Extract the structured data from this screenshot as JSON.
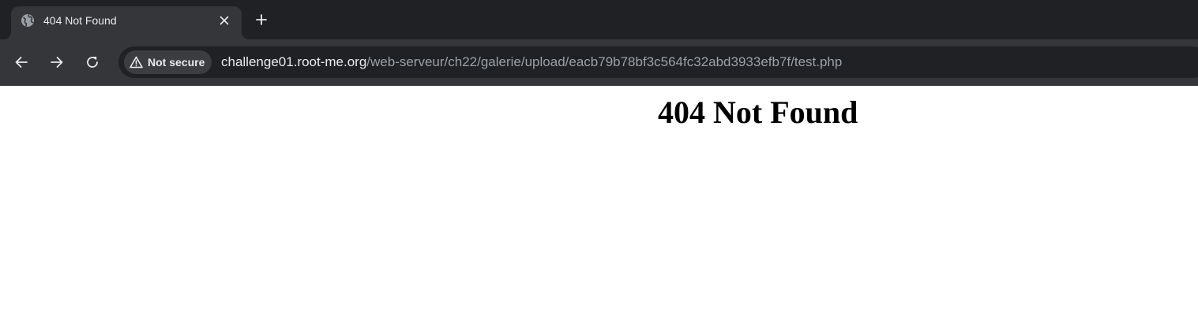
{
  "browser": {
    "tab": {
      "title": "404 Not Found",
      "favicon_icon": "globe-icon",
      "close_icon": "close-icon"
    },
    "new_tab_icon": "plus-icon",
    "toolbar": {
      "back_icon": "arrow-left-icon",
      "forward_icon": "arrow-right-icon",
      "reload_icon": "reload-icon"
    },
    "omnibox": {
      "security_icon": "warning-triangle-icon",
      "security_label": "Not secure",
      "url_host": "challenge01.root-me.org",
      "url_path": "/web-serveur/ch22/galerie/upload/eacb79b78bf3c564fc32abd3933efb7f/test.php"
    }
  },
  "page": {
    "heading": "404 Not Found"
  },
  "colors": {
    "tab_strip_bg": "#202124",
    "toolbar_bg": "#35363a",
    "omnibox_bg": "#202124",
    "text_primary": "#e8eaed",
    "text_secondary": "#9aa0a6",
    "page_bg": "#ffffff"
  }
}
